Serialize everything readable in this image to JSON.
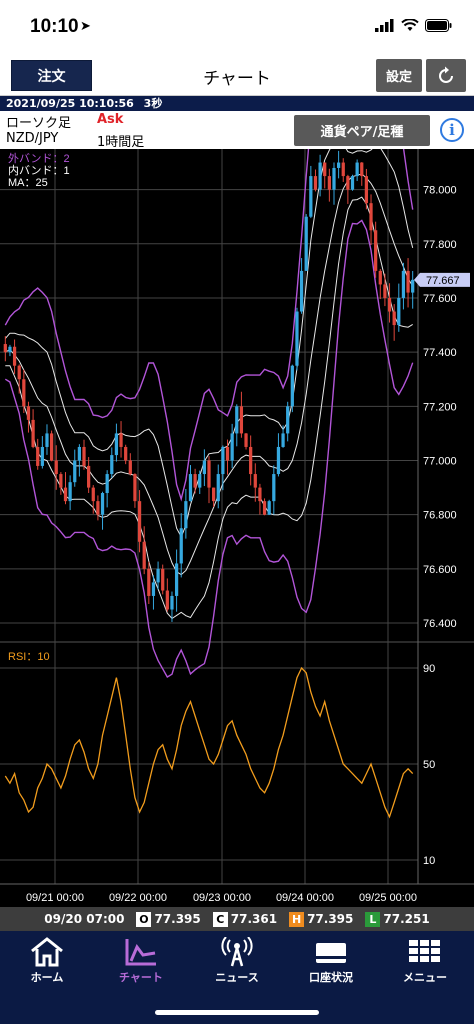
{
  "status": {
    "time": "10:10",
    "location_icon": "location-arrow-icon"
  },
  "nav": {
    "order_label": "注文",
    "title": "チャート",
    "settings_label": "設定"
  },
  "info": {
    "datetime": "2021/09/25 10:10:56",
    "interval": "3秒",
    "candle_label": "ローソク足",
    "price_side": "Ask",
    "pair": "NZD/JPY",
    "timeframe": "1時間足",
    "pair_button": "通貨ペア/足種"
  },
  "chart": {
    "legend": [
      "外バンド：2",
      "内バンド：1",
      "MA：25"
    ],
    "rsi_label": "RSI：10",
    "current_price": "77.667",
    "price_ticks": [
      "78.000",
      "77.800",
      "77.600",
      "77.400",
      "77.200",
      "77.000",
      "76.800",
      "76.600",
      "76.400"
    ],
    "rsi_ticks": [
      "90",
      "50",
      "10"
    ],
    "x_ticks": [
      "09/21 00:00",
      "09/22 00:00",
      "09/23 00:00",
      "09/24 00:00",
      "09/25 00:00"
    ]
  },
  "chart_data": {
    "type": "candlestick",
    "y_range": [
      76.33,
      78.15
    ],
    "rsi_range": [
      0,
      100
    ],
    "current_price": 77.667,
    "close_series": [
      77.4,
      77.42,
      77.35,
      77.3,
      77.2,
      77.15,
      77.05,
      76.98,
      77.05,
      77.1,
      77.0,
      76.95,
      76.9,
      76.85,
      76.92,
      77.0,
      77.05,
      76.98,
      76.9,
      76.85,
      76.8,
      76.88,
      76.95,
      77.02,
      77.1,
      77.05,
      77.0,
      76.95,
      76.85,
      76.7,
      76.6,
      76.5,
      76.55,
      76.6,
      76.52,
      76.45,
      76.5,
      76.62,
      76.75,
      76.85,
      76.95,
      76.9,
      76.95,
      77.0,
      76.9,
      76.85,
      76.95,
      77.05,
      77.0,
      77.1,
      77.2,
      77.1,
      77.05,
      76.95,
      76.9,
      76.85,
      76.8,
      76.85,
      76.95,
      77.05,
      77.1,
      77.2,
      77.35,
      77.55,
      77.7,
      77.9,
      78.05,
      78.0,
      78.1,
      78.05,
      78.0,
      78.08,
      78.1,
      78.05,
      78.0,
      78.05,
      78.1,
      78.05,
      77.95,
      77.85,
      77.7,
      77.65,
      77.6,
      77.55,
      77.5,
      77.6,
      77.7,
      77.62,
      77.667
    ],
    "rsi_series": [
      45,
      42,
      46,
      38,
      35,
      30,
      32,
      40,
      44,
      50,
      48,
      44,
      40,
      45,
      52,
      58,
      60,
      55,
      48,
      44,
      50,
      62,
      70,
      78,
      86,
      76,
      62,
      48,
      36,
      30,
      34,
      42,
      50,
      56,
      58,
      52,
      48,
      56,
      66,
      72,
      76,
      70,
      64,
      58,
      52,
      50,
      54,
      60,
      66,
      68,
      62,
      58,
      54,
      48,
      44,
      40,
      38,
      42,
      48,
      56,
      62,
      70,
      78,
      86,
      90,
      88,
      80,
      74,
      70,
      76,
      68,
      62,
      56,
      50,
      48,
      46,
      44,
      42,
      46,
      50,
      44,
      38,
      32,
      28,
      34,
      40,
      46,
      48,
      46
    ]
  },
  "ohlc": {
    "time": "09/20 07:00",
    "o_label": "O",
    "o_value": "77.395",
    "c_label": "C",
    "c_value": "77.361",
    "h_label": "H",
    "h_value": "77.395",
    "l_label": "L",
    "l_value": "77.251",
    "colors": {
      "o": "#ffffff",
      "c": "#ffffff",
      "h": "#f08c1e",
      "l": "#2a9a3a"
    }
  },
  "tabs": [
    {
      "label": "ホーム",
      "icon": "home-icon"
    },
    {
      "label": "チャート",
      "icon": "chart-icon"
    },
    {
      "label": "ニュース",
      "icon": "news-antenna-icon"
    },
    {
      "label": "口座状況",
      "icon": "account-card-icon"
    },
    {
      "label": "メニュー",
      "icon": "menu-grid-icon"
    }
  ],
  "colors": {
    "up": "#36a9e0",
    "down": "#e0473c",
    "outer_band": "#b255d8",
    "inner_band": "#e8e8e8",
    "rsi": "#f29d1d",
    "nav_dark": "#0b1a44",
    "active_tab": "#b86cd8"
  }
}
